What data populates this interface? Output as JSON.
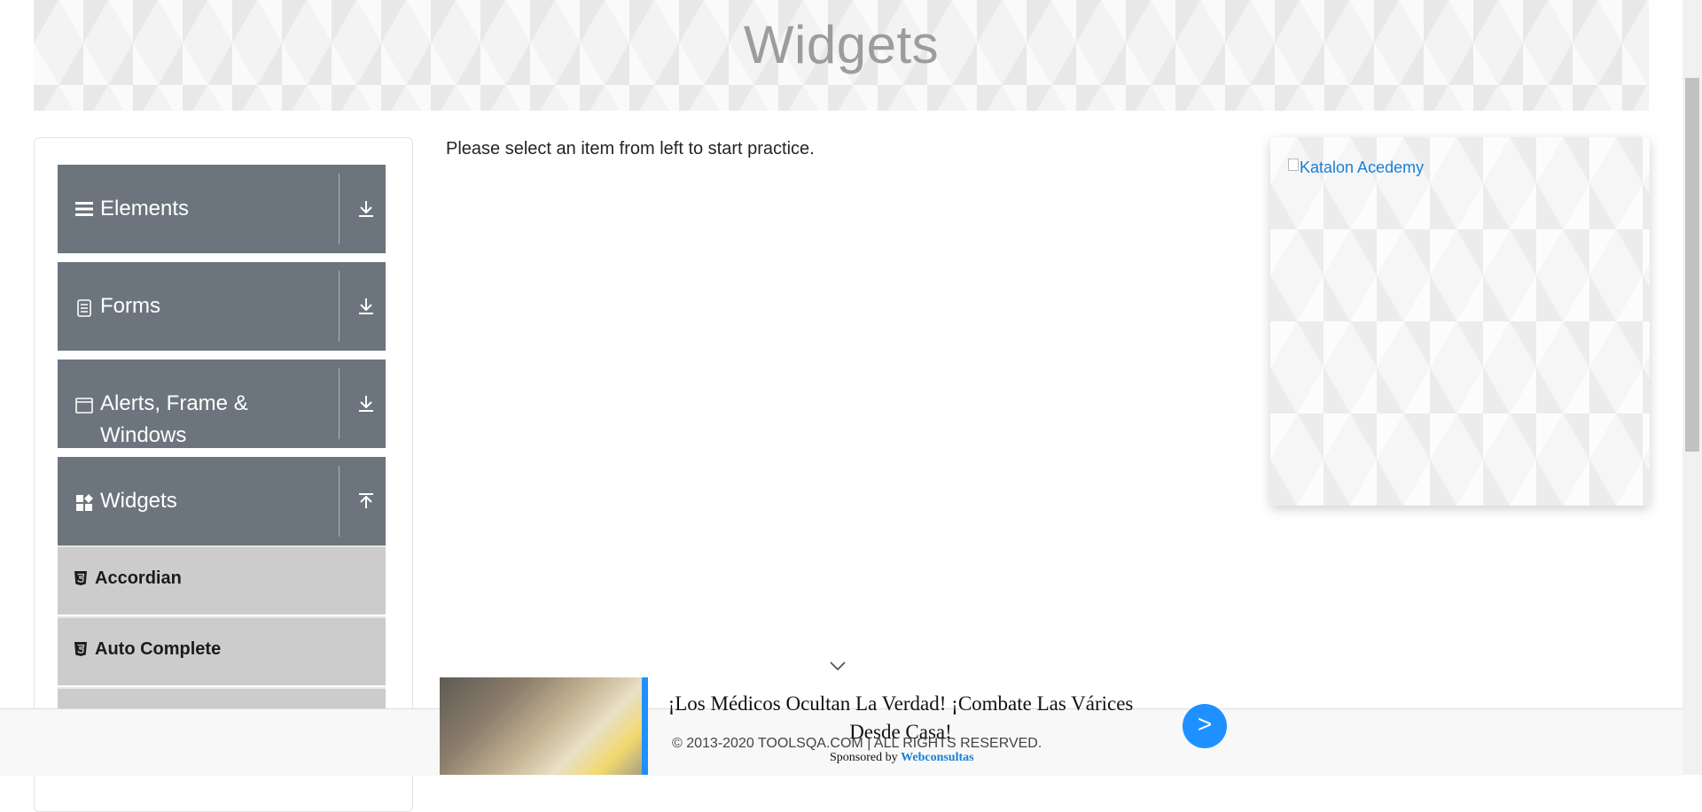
{
  "page": {
    "title": "Widgets"
  },
  "intro_text": "Please select an item from left to start practice.",
  "sidebar": {
    "groups": [
      {
        "label": "Elements",
        "icon": "menu-icon"
      },
      {
        "label": "Forms",
        "icon": "document-icon"
      },
      {
        "label": "Alerts, Frame &",
        "label_line2": "Windows",
        "icon": "window-icon"
      },
      {
        "label": "Widgets",
        "icon": "widgets-icon",
        "expanded": true
      }
    ],
    "items": [
      {
        "label": "Accordian",
        "icon": "html5-icon"
      },
      {
        "label": "Auto Complete",
        "icon": "html5-icon"
      }
    ]
  },
  "ad": {
    "alt_text": "Katalon Acedemy"
  },
  "footer": {
    "copyright": "© 2013-2020 TOOLSQA.COM | ALL RIGHTS RESERVED."
  },
  "popup_ad": {
    "headline": "¡Los Médicos Ocultan La Verdad! ¡Combate Las Várices Desde Casa!",
    "sponsored_prefix": "Sponsored by",
    "sponsor": "Webconsultas",
    "go_label": ">"
  },
  "colors": {
    "sidebar_group": "#6c757d",
    "sidebar_item": "#cccccc",
    "accent": "#1e90ff"
  }
}
